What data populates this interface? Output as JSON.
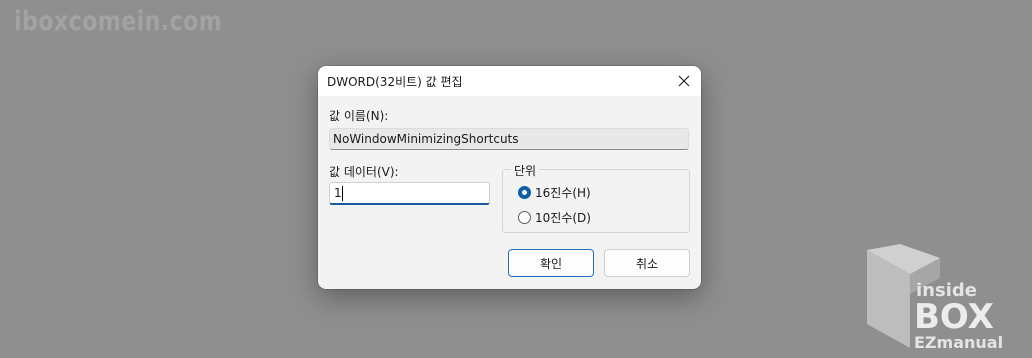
{
  "watermark": "iboxcomein.com",
  "dialog": {
    "title": "DWORD(32비트) 값 편집",
    "name_label": "값 이름(N):",
    "name_value": "NoWindowMinimizingShortcuts",
    "data_label": "값 데이터(V):",
    "data_value": "1",
    "base_label": "단위",
    "base_options": [
      {
        "label": "16진수(H)",
        "selected": true
      },
      {
        "label": "10진수(D)",
        "selected": false
      }
    ],
    "ok_label": "확인",
    "cancel_label": "취소"
  },
  "logo": {
    "line1": "inside",
    "line2": "BOX",
    "line3": "EZmanual"
  },
  "colors": {
    "background": "#8f8f8f",
    "accent": "#0f5ea8"
  }
}
